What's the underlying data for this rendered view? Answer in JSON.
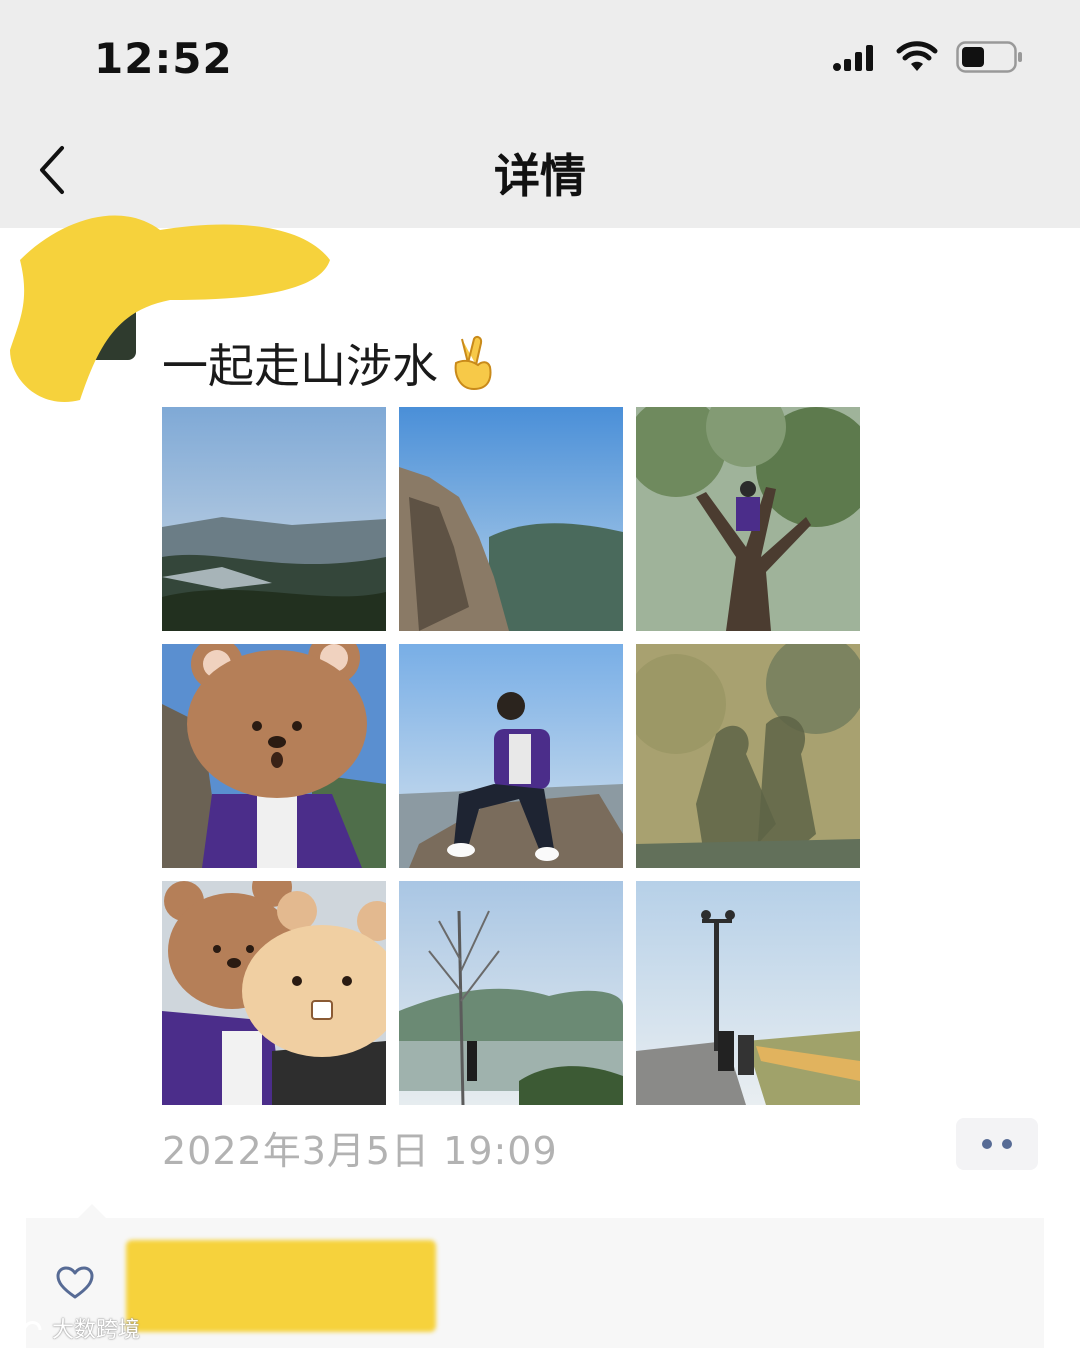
{
  "status_bar": {
    "time": "12:52"
  },
  "nav": {
    "title": "详情",
    "back_icon": "chevron-left-icon"
  },
  "post": {
    "text": "一起走山涉水",
    "emoji": "✌️",
    "timestamp": "2022年3月5日 19:09",
    "photos": [
      {
        "name": "photo-mountain-valley-view"
      },
      {
        "name": "photo-cliff-rock-face"
      },
      {
        "name": "photo-person-in-tree"
      },
      {
        "name": "photo-selfie-bear-sticker"
      },
      {
        "name": "photo-person-sitting-on-rock"
      },
      {
        "name": "photo-shadow-on-grass"
      },
      {
        "name": "photo-couple-bear-stickers"
      },
      {
        "name": "photo-lake-and-tree"
      },
      {
        "name": "photo-walkway-with-lamp"
      }
    ]
  },
  "likes": {
    "icon": "heart-icon"
  },
  "watermark": {
    "text": "大数跨境"
  },
  "colors": {
    "nav_bg": "#ededed",
    "link_blue": "#576b95",
    "timestamp_gray": "#b2b2b2",
    "redaction_yellow": "#f6d23c"
  }
}
